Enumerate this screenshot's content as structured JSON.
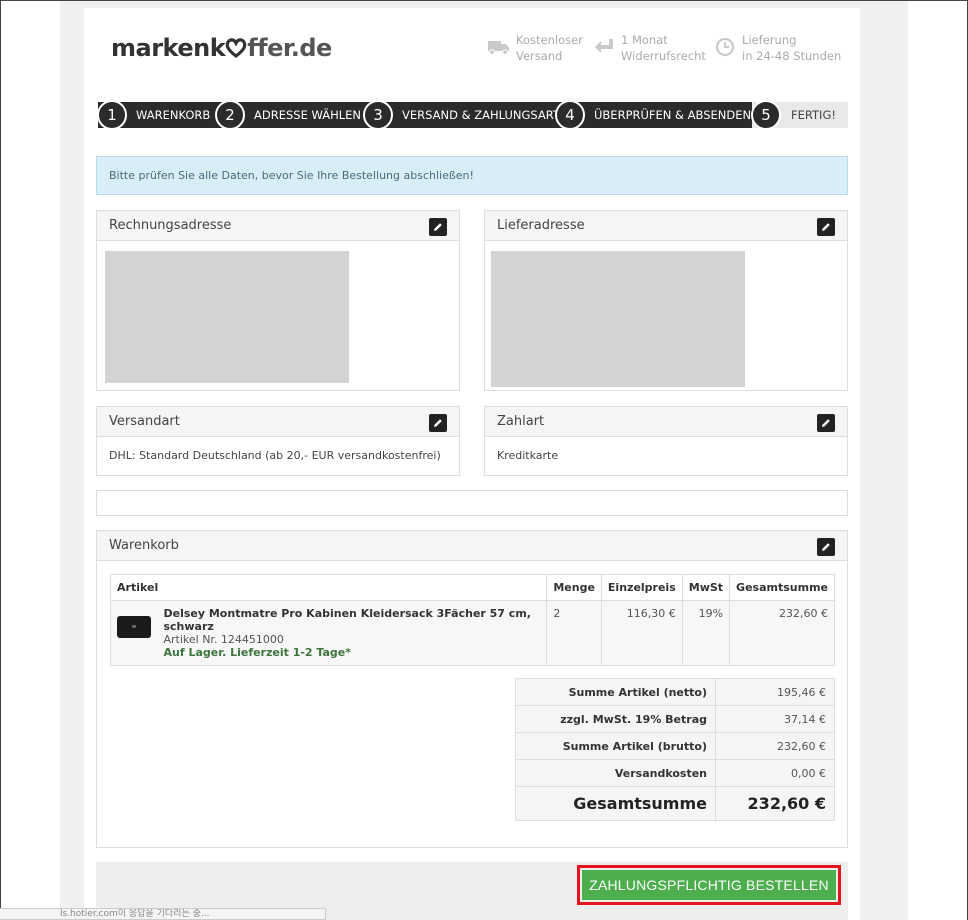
{
  "logo": {
    "part1": "marken",
    "part2": "k",
    "part3": "ffer.de"
  },
  "usps": [
    {
      "icon": "truck-icon",
      "line1": "Kostenloser",
      "line2": "Versand"
    },
    {
      "icon": "return-arrow-icon",
      "line1": "1 Monat",
      "line2": "Widerrufsrecht"
    },
    {
      "icon": "clock-icon",
      "line1": "Lieferung",
      "line2": "in 24-48 Stunden"
    }
  ],
  "steps": [
    {
      "num": "1",
      "label": "WARENKORB"
    },
    {
      "num": "2",
      "label": "ADRESSE WÄHLEN"
    },
    {
      "num": "3",
      "label": "VERSAND & ZAHLUNGSART"
    },
    {
      "num": "4",
      "label": "ÜBERPRÜFEN & ABSENDEN"
    },
    {
      "num": "5",
      "label": "FERTIG!"
    }
  ],
  "alert": "Bitte prüfen Sie alle Daten, bevor Sie Ihre Bestellung abschließen!",
  "panels": {
    "billing": {
      "title": "Rechnungsadresse"
    },
    "shipping": {
      "title": "Lieferadresse"
    },
    "shipping_method": {
      "title": "Versandart",
      "value": "DHL: Standard Deutschland (ab 20,- EUR versandkostenfrei)"
    },
    "payment": {
      "title": "Zahlart",
      "value": "Kreditkarte"
    },
    "cart": {
      "title": "Warenkorb"
    }
  },
  "cart_table": {
    "headers": [
      "Artikel",
      "Menge",
      "Einzelpreis",
      "MwSt",
      "Gesamtsumme"
    ],
    "item": {
      "title": "Delsey Montmatre Pro Kabinen Kleidersack 3Fächer 57 cm, schwarz",
      "article_no": "Artikel Nr. 124451000",
      "stock": "Auf Lager. Lieferzeit 1-2 Tage*",
      "qty": "2",
      "unit_price": "116,30 €",
      "vat": "19%",
      "total": "232,60 €"
    }
  },
  "summary": [
    {
      "label": "Summe Artikel (netto)",
      "value": "195,46 €"
    },
    {
      "label": "zzgl. MwSt. 19% Betrag",
      "value": "37,14 €"
    },
    {
      "label": "Summe Artikel (brutto)",
      "value": "232,60 €"
    },
    {
      "label": "Versandkosten",
      "value": "0,00 €"
    }
  ],
  "grand_total": {
    "label": "Gesamtsumme",
    "value": "232,60 €"
  },
  "order_button": "ZAHLUNGSPFLICHTIG BESTELLEN",
  "status_bar": "ls.hotier.com이 응답을 기다리는 중...",
  "colors": {
    "accent_green": "#4cae4c",
    "highlight_red": "#e3141a",
    "dark": "#2b2b2b",
    "stock_green": "#3c763d"
  }
}
